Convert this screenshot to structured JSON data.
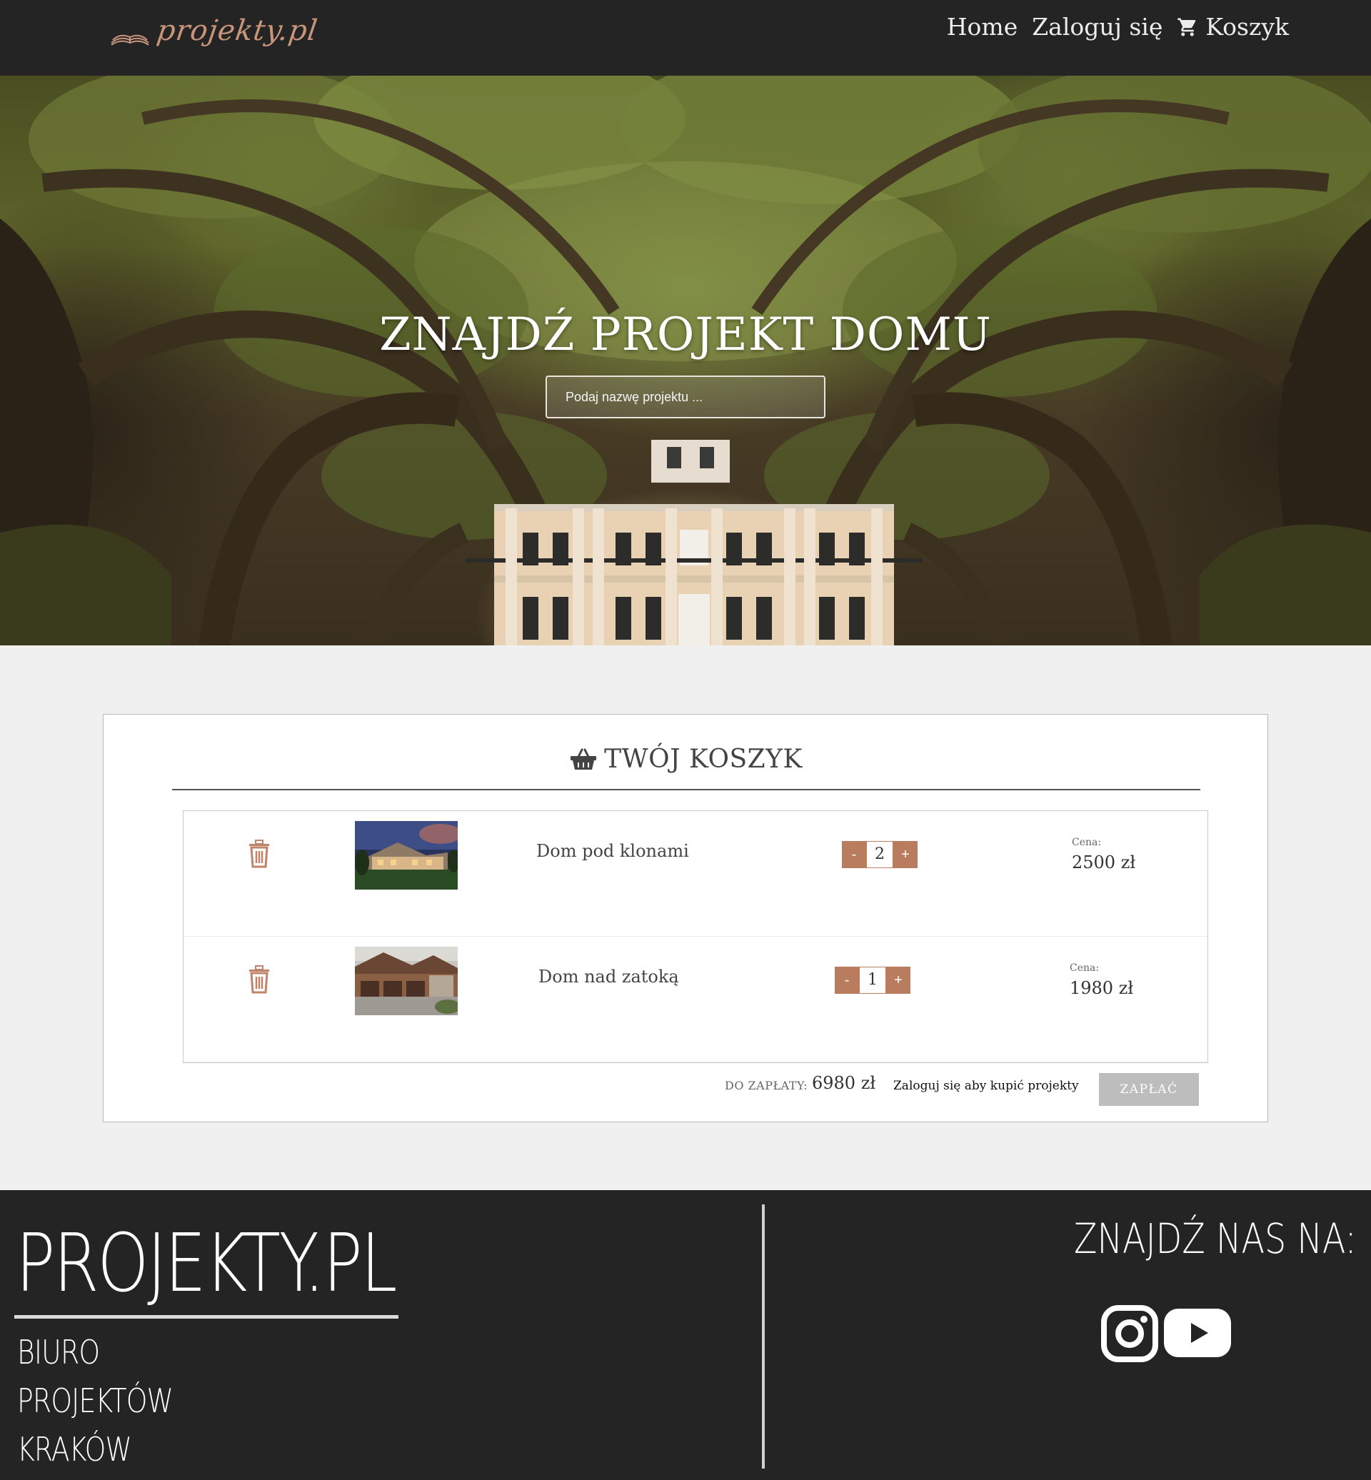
{
  "nav": {
    "logo_text": "projekty.pl",
    "home": "Home",
    "login": "Zaloguj się",
    "cart": "Koszyk"
  },
  "hero": {
    "title": "ZNAJDŹ PROJEKT DOMU",
    "search_placeholder": "Podaj nazwę projektu ..."
  },
  "cart": {
    "title": "TWÓJ KOSZYK",
    "items": [
      {
        "name": "Dom pod klonami",
        "quantity": "2",
        "price_label": "Cena:",
        "price": "2500 zł"
      },
      {
        "name": "Dom nad zatoką",
        "quantity": "1",
        "price_label": "Cena:",
        "price": "1980 zł"
      }
    ],
    "minus": "-",
    "plus": "+",
    "total_label": "DO ZAPŁATY:",
    "total_value": "6980 zł",
    "login_note": "Zaloguj się aby kupić projekty",
    "pay_button": "ZAPŁAĆ"
  },
  "footer": {
    "brand": "PROJEKTY.PL",
    "sub_lines": [
      "BIURO",
      "PROJEKTÓW",
      "KRAKÓW"
    ],
    "find_us": "ZNAJDŹ NAS NA:",
    "socials": [
      "instagram-icon",
      "youtube-icon"
    ]
  },
  "colors": {
    "nav_bg": "#242424",
    "accent": "#b97c5e",
    "page_bg": "#f0f0f0",
    "pay_disabled": "#bdbdbd"
  }
}
